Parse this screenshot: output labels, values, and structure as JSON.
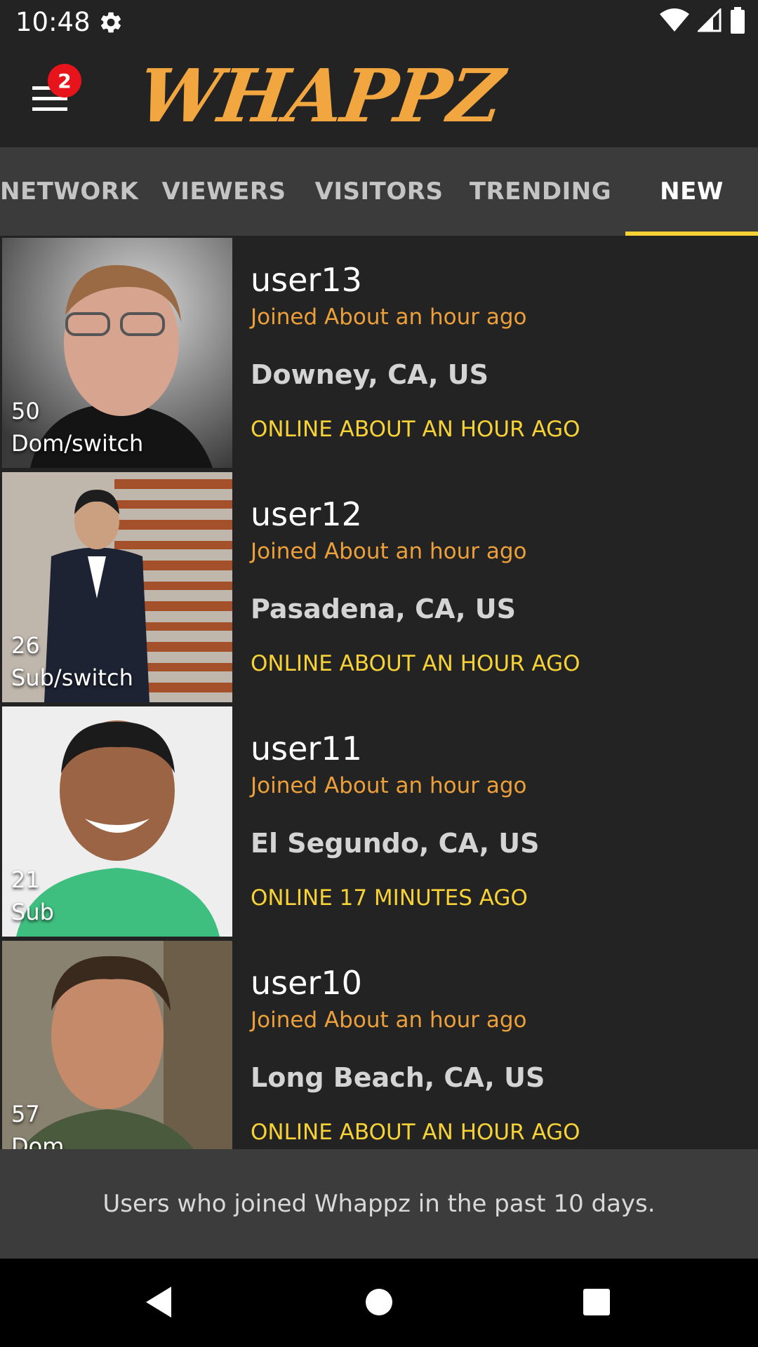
{
  "status_bar": {
    "time": "10:48",
    "icons": [
      "gear-icon",
      "wifi-icon",
      "signal-icon",
      "battery-icon"
    ]
  },
  "app_bar": {
    "logo_text": "WHAPPZ",
    "menu_icon": "hamburger-menu-icon",
    "badge_count": "2",
    "logo_color": "#f2a640"
  },
  "tabs": [
    {
      "label": "NETWORK",
      "active": false
    },
    {
      "label": "VIEWERS",
      "active": false
    },
    {
      "label": "VISITORS",
      "active": false
    },
    {
      "label": "TRENDING",
      "active": false
    },
    {
      "label": "NEW",
      "active": true
    }
  ],
  "users": [
    {
      "username": "user13",
      "joined": "Joined About an hour ago",
      "location": "Downey, CA, US",
      "online": "ONLINE ABOUT AN HOUR AGO",
      "age": "50",
      "role": "Dom/switch"
    },
    {
      "username": "user12",
      "joined": "Joined About an hour ago",
      "location": "Pasadena, CA, US",
      "online": "ONLINE ABOUT AN HOUR AGO",
      "age": "26",
      "role": "Sub/switch"
    },
    {
      "username": "user11",
      "joined": "Joined About an hour ago",
      "location": "El Segundo, CA, US",
      "online": "ONLINE 17 MINUTES AGO",
      "age": "21",
      "role": "Sub"
    },
    {
      "username": "user10",
      "joined": "Joined About an hour ago",
      "location": "Long Beach, CA, US",
      "online": "ONLINE ABOUT AN HOUR AGO",
      "age": "57",
      "role": "Dom"
    }
  ],
  "footer_info": "Users who joined Whappz in the past 10 days.",
  "nav_bar": {
    "icons": [
      "back-icon",
      "home-icon",
      "recents-icon"
    ]
  },
  "colors": {
    "accent_yellow": "#f7d237",
    "joined_orange": "#eda03a",
    "background": "#232323",
    "tab_bar": "#3b3b3b",
    "badge_red": "#e8141c"
  }
}
